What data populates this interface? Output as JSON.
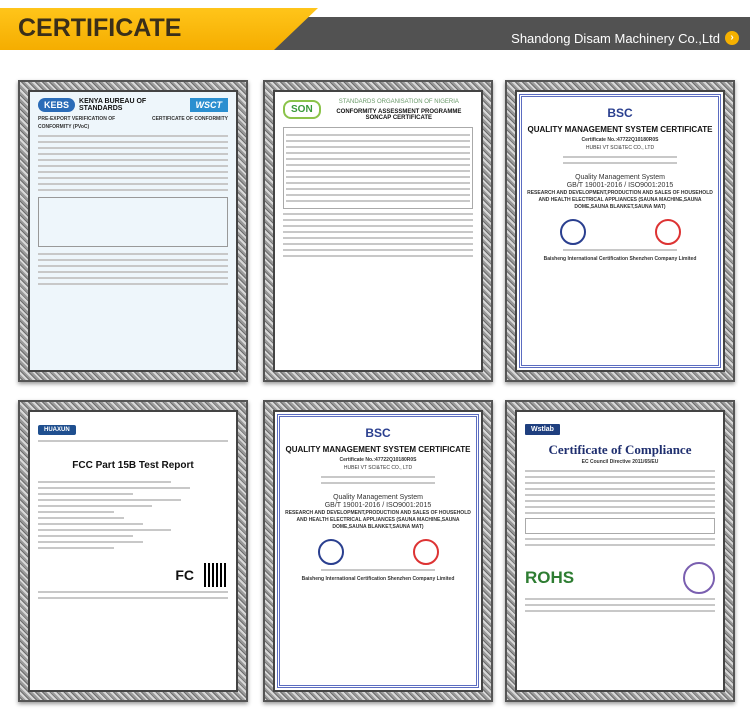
{
  "header": {
    "title": "CERTIFICATE",
    "company": "Shandong Disam Machinery Co.,Ltd",
    "arrow_icon": "chevron-right-circle-icon",
    "accent": "#f5b000"
  },
  "certificates": [
    {
      "logo": "KEBS",
      "logo2": "WSCT",
      "title": "KENYA BUREAU OF STANDARDS",
      "subtitle": "PRE-EXPORT VERIFICATION OF CONFORMITY (PVoC)",
      "subtitle2": "CERTIFICATE OF CONFORMITY"
    },
    {
      "logo": "SON",
      "title": "STANDARDS ORGANISATION OF NIGERIA",
      "subtitle": "CONFORMITY ASSESSMENT PROGRAMME",
      "subtitle2": "SONCAP CERTIFICATE"
    },
    {
      "logo": "BSC",
      "title": "QUALITY MANAGEMENT SYSTEM CERTIFICATE",
      "number": "Certificate No.:47722Q10180R0S",
      "company": "HUBEI VT SCI&TEC CO., LTD",
      "system": "Quality Management System",
      "standard": "GB/T 19001-2016 / ISO9001:2015",
      "scope": "RESEARCH AND DEVELOPMENT,PRODUCTION AND SALES OF HOUSEHOLD AND HEALTH ELECTRICAL APPLIANCES (SAUNA MACHINE,SAUNA DOME,SAUNA BLANKET,SAUNA MAT)",
      "issuer": "Baisheng International Certification Shenzhen Company Limited"
    },
    {
      "logo": "HUAXUN",
      "title": "FCC Part 15B Test Report",
      "marks": "FC"
    },
    {
      "logo": "BSC",
      "title": "QUALITY MANAGEMENT SYSTEM CERTIFICATE",
      "number": "Certificate No.:47722Q10180R0S",
      "company": "HUBEI VT SCI&TEC CO., LTD",
      "system": "Quality Management System",
      "standard": "GB/T 19001-2016 / ISO9001:2015",
      "scope": "RESEARCH AND DEVELOPMENT,PRODUCTION AND SALES OF HOUSEHOLD AND HEALTH ELECTRICAL APPLIANCES (SAUNA MACHINE,SAUNA DOME,SAUNA BLANKET,SAUNA MAT)",
      "issuer": "Baisheng International Certification Shenzhen Company Limited"
    },
    {
      "logo": "Wstlab",
      "title": "Certificate of Compliance",
      "subtitle": "EC Council Directive 2011/65/EU",
      "mark": "ROHS"
    }
  ]
}
